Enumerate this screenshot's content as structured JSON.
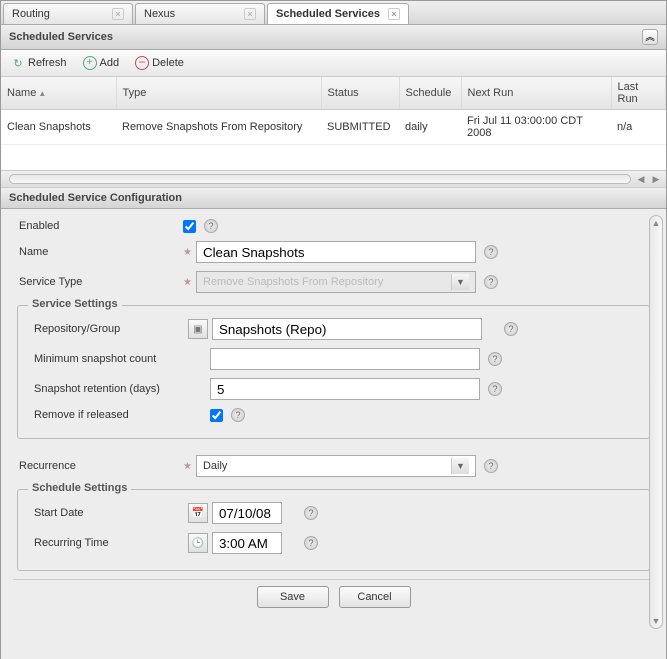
{
  "tabs": [
    {
      "label": "Routing",
      "active": false
    },
    {
      "label": "Nexus",
      "active": false
    },
    {
      "label": "Scheduled Services",
      "active": true
    }
  ],
  "panel": {
    "title": "Scheduled Services"
  },
  "toolbar": {
    "refresh": "Refresh",
    "add": "Add",
    "delete": "Delete"
  },
  "grid": {
    "columns": {
      "name": "Name",
      "type": "Type",
      "status": "Status",
      "schedule": "Schedule",
      "next_run": "Next Run",
      "last_run": "Last Run"
    },
    "rows": [
      {
        "name": "Clean Snapshots",
        "type": "Remove Snapshots From Repository",
        "status": "SUBMITTED",
        "schedule": "daily",
        "next_run": "Fri Jul 11 03:00:00 CDT 2008",
        "last_run": "n/a"
      }
    ]
  },
  "config": {
    "title": "Scheduled Service Configuration",
    "enabled_label": "Enabled",
    "enabled": true,
    "name_label": "Name",
    "name_value": "Clean Snapshots",
    "service_type_label": "Service Type",
    "service_type_value": "Remove Snapshots From Repository",
    "service_settings_legend": "Service Settings",
    "repo_label": "Repository/Group",
    "repo_value": "Snapshots (Repo)",
    "min_snap_label": "Minimum snapshot count",
    "min_snap_value": "",
    "retention_label": "Snapshot retention (days)",
    "retention_value": "5",
    "remove_released_label": "Remove if released",
    "remove_released": true,
    "recurrence_label": "Recurrence",
    "recurrence_value": "Daily",
    "schedule_settings_legend": "Schedule Settings",
    "start_date_label": "Start Date",
    "start_date_value": "07/10/08",
    "recurring_time_label": "Recurring Time",
    "recurring_time_value": "3:00 AM",
    "save": "Save",
    "cancel": "Cancel"
  }
}
